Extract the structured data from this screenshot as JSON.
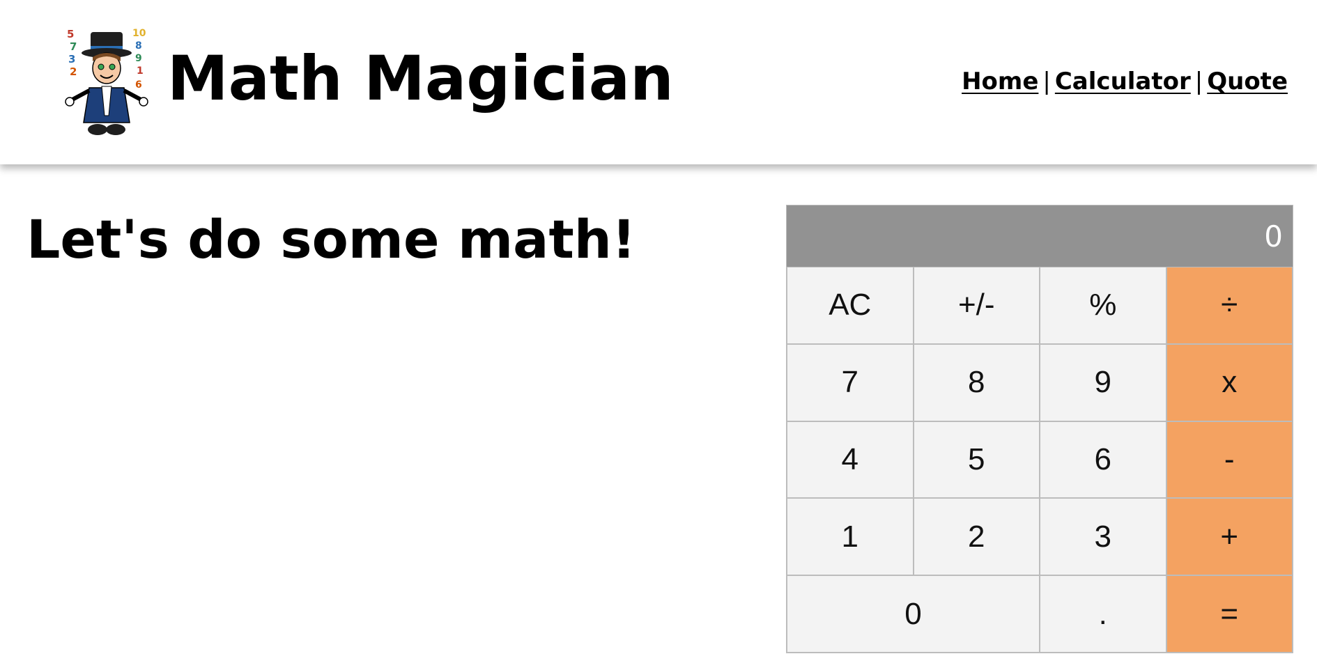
{
  "header": {
    "title": "Math Magician",
    "logo_numbers_left": [
      "5",
      "7",
      "3",
      "2"
    ],
    "logo_numbers_right": [
      "10",
      "8",
      "9",
      "1",
      "6"
    ],
    "nav": [
      {
        "label": "Home"
      },
      {
        "label": "Calculator"
      },
      {
        "label": "Quote"
      }
    ],
    "nav_separator": "|"
  },
  "main": {
    "heading": "Let's do some math!"
  },
  "calculator": {
    "display": "0",
    "keys": [
      {
        "label": "AC"
      },
      {
        "label": "+/-"
      },
      {
        "label": "%"
      },
      {
        "label": "÷"
      },
      {
        "label": "7"
      },
      {
        "label": "8"
      },
      {
        "label": "9"
      },
      {
        "label": "x"
      },
      {
        "label": "4"
      },
      {
        "label": "5"
      },
      {
        "label": "6"
      },
      {
        "label": "-"
      },
      {
        "label": "1"
      },
      {
        "label": "2"
      },
      {
        "label": "3"
      },
      {
        "label": "+"
      },
      {
        "label": "0"
      },
      {
        "label": "."
      },
      {
        "label": "="
      }
    ]
  },
  "colors": {
    "display_bg": "#929292",
    "key_bg": "#f3f3f3",
    "operator_bg": "#f4a261"
  }
}
